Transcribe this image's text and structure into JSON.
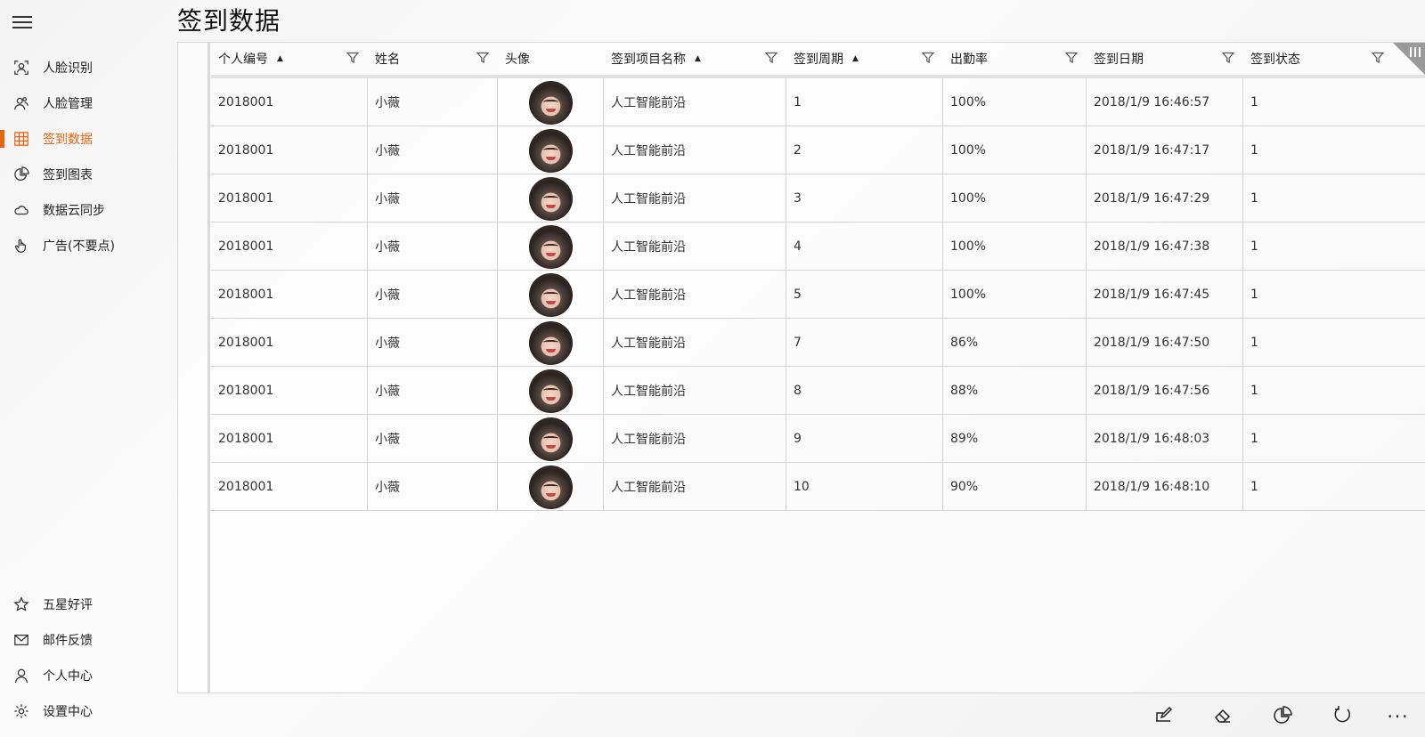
{
  "page": {
    "title": "签到数据"
  },
  "colors": {
    "accent": "#e8640f"
  },
  "sidebar": {
    "items": [
      {
        "label": "人脸识别",
        "icon": "face-scan-icon"
      },
      {
        "label": "人脸管理",
        "icon": "people-icon"
      },
      {
        "label": "签到数据",
        "icon": "grid-icon",
        "active": true
      },
      {
        "label": "签到图表",
        "icon": "pie-chart-icon"
      },
      {
        "label": "数据云同步",
        "icon": "cloud-icon"
      },
      {
        "label": "广告(不要点)",
        "icon": "hand-pointer-icon"
      }
    ],
    "bottom_items": [
      {
        "label": "五星好评",
        "icon": "star-icon"
      },
      {
        "label": "邮件反馈",
        "icon": "mail-icon"
      },
      {
        "label": "个人中心",
        "icon": "person-icon"
      },
      {
        "label": "设置中心",
        "icon": "gear-icon"
      }
    ]
  },
  "table": {
    "columns": [
      {
        "label": "个人编号",
        "sorted": "▲",
        "filter": true
      },
      {
        "label": "姓名",
        "sorted": "",
        "filter": true
      },
      {
        "label": "头像",
        "sorted": "",
        "filter": false
      },
      {
        "label": "签到项目名称",
        "sorted": "▲",
        "filter": true
      },
      {
        "label": "签到周期",
        "sorted": "▲",
        "filter": true
      },
      {
        "label": "出勤率",
        "sorted": "",
        "filter": true
      },
      {
        "label": "签到日期",
        "sorted": "",
        "filter": true
      },
      {
        "label": "签到状态",
        "sorted": "",
        "filter": true
      }
    ],
    "rows": [
      [
        "2018001",
        "小薇",
        "",
        "人工智能前沿",
        "1",
        "100%",
        "2018/1/9 16:46:57",
        "1"
      ],
      [
        "2018001",
        "小薇",
        "",
        "人工智能前沿",
        "2",
        "100%",
        "2018/1/9 16:47:17",
        "1"
      ],
      [
        "2018001",
        "小薇",
        "",
        "人工智能前沿",
        "3",
        "100%",
        "2018/1/9 16:47:29",
        "1"
      ],
      [
        "2018001",
        "小薇",
        "",
        "人工智能前沿",
        "4",
        "100%",
        "2018/1/9 16:47:38",
        "1"
      ],
      [
        "2018001",
        "小薇",
        "",
        "人工智能前沿",
        "5",
        "100%",
        "2018/1/9 16:47:45",
        "1"
      ],
      [
        "2018001",
        "小薇",
        "",
        "人工智能前沿",
        "7",
        "86%",
        "2018/1/9 16:47:50",
        "1"
      ],
      [
        "2018001",
        "小薇",
        "",
        "人工智能前沿",
        "8",
        "88%",
        "2018/1/9 16:47:56",
        "1"
      ],
      [
        "2018001",
        "小薇",
        "",
        "人工智能前沿",
        "9",
        "89%",
        "2018/1/9 16:48:03",
        "1"
      ],
      [
        "2018001",
        "小薇",
        "",
        "人工智能前沿",
        "10",
        "90%",
        "2018/1/9 16:48:10",
        "1"
      ]
    ]
  },
  "toolbar": {
    "buttons": [
      {
        "icon": "edit-icon"
      },
      {
        "icon": "eraser-icon"
      },
      {
        "icon": "pie-chart-icon"
      },
      {
        "icon": "refresh-icon"
      }
    ],
    "more_label": "···"
  }
}
